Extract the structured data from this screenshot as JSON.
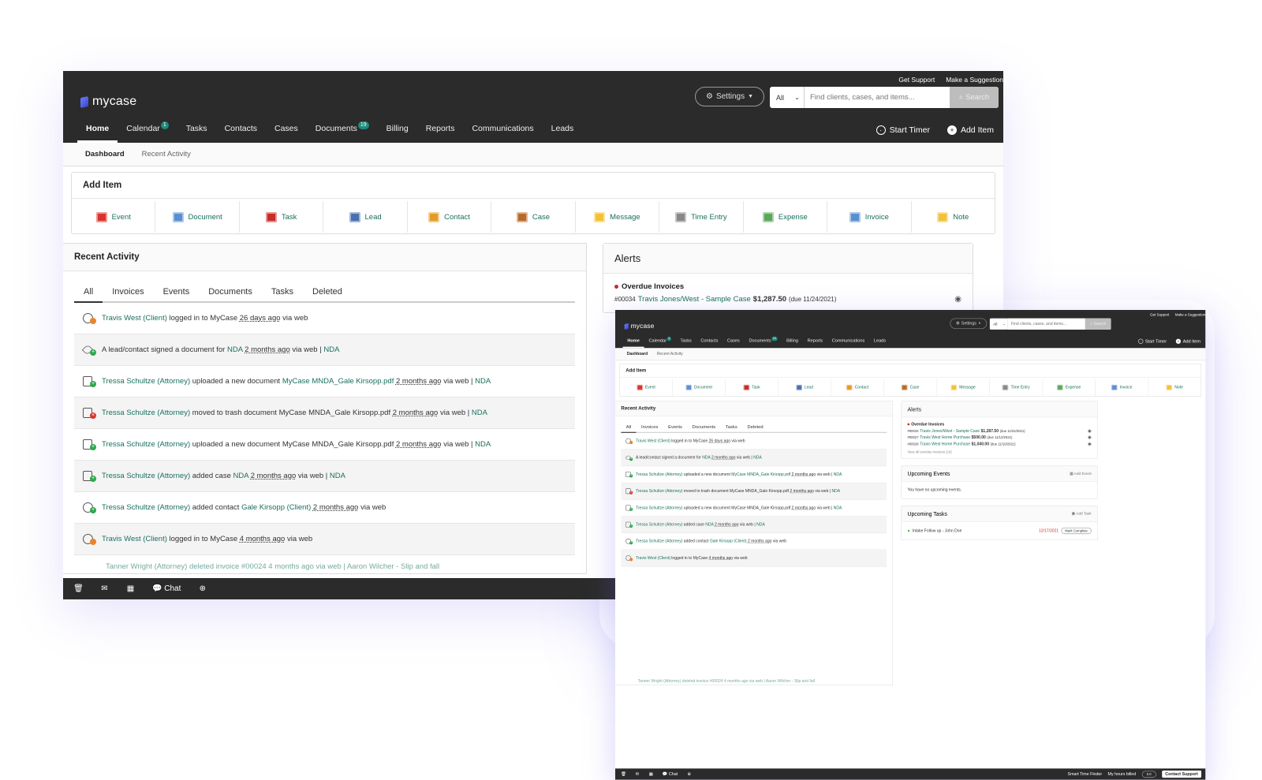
{
  "toplinks": [
    "Get Support",
    "Make a Suggestion"
  ],
  "logo": "mycase",
  "settings": "Settings",
  "search": {
    "scope": "All",
    "placeholder": "Find clients, cases, and items...",
    "button": "Search"
  },
  "nav": [
    {
      "label": "Home",
      "badge": ""
    },
    {
      "label": "Calendar",
      "badge": "1"
    },
    {
      "label": "Tasks",
      "badge": ""
    },
    {
      "label": "Contacts",
      "badge": ""
    },
    {
      "label": "Cases",
      "badge": ""
    },
    {
      "label": "Documents",
      "badge": "19"
    },
    {
      "label": "Billing",
      "badge": ""
    },
    {
      "label": "Reports",
      "badge": ""
    },
    {
      "label": "Communications",
      "badge": ""
    },
    {
      "label": "Leads",
      "badge": ""
    }
  ],
  "nav_right": {
    "timer": "Start Timer",
    "add": "Add Item"
  },
  "subnav": [
    "Dashboard",
    "Recent Activity"
  ],
  "add_item": {
    "title": "Add Item",
    "items": [
      {
        "label": "Event",
        "color": "#d9342b"
      },
      {
        "label": "Document",
        "color": "#5a8fd0"
      },
      {
        "label": "Task",
        "color": "#c62d28"
      },
      {
        "label": "Lead",
        "color": "#4a6fb0"
      },
      {
        "label": "Contact",
        "color": "#e39a2a"
      },
      {
        "label": "Case",
        "color": "#b86a2a"
      },
      {
        "label": "Message",
        "color": "#f0c23a"
      },
      {
        "label": "Time Entry",
        "color": "#888888"
      },
      {
        "label": "Expense",
        "color": "#5aa85a"
      },
      {
        "label": "Invoice",
        "color": "#5a8fd0"
      },
      {
        "label": "Note",
        "color": "#f0c23a"
      }
    ]
  },
  "recent": {
    "title": "Recent Activity",
    "tabs": [
      "All",
      "Invoices",
      "Events",
      "Documents",
      "Tasks",
      "Deleted"
    ],
    "rows": [
      {
        "icon": "client-login-icon",
        "type": "person",
        "badge": "orange",
        "a": "Travis West (Client)",
        "b": "logged in to MyCase",
        "t": "26 days ago",
        "c": "via web",
        "d": ""
      },
      {
        "icon": "signed-document-icon",
        "type": "pen",
        "badge": "green",
        "a": "",
        "b": "A lead/contact signed a document for",
        "a2": "NDA",
        "t": "2 months ago",
        "c": "via web |",
        "d": "NDA"
      },
      {
        "icon": "document-add-icon",
        "type": "doc",
        "badge": "green",
        "a": "Tressa Schultze (Attorney)",
        "b": "uploaded a new document",
        "a2": "MyCase MNDA_Gale Kirsopp.pdf",
        "t": "2 months ago",
        "c": "via web |",
        "d": "NDA"
      },
      {
        "icon": "document-trash-icon",
        "type": "doc",
        "badge": "red",
        "a": "Tressa Schultze (Attorney)",
        "b": "moved to trash document MyCase MNDA_Gale Kirsopp.pdf",
        "t": "2 months ago",
        "c": "via web |",
        "d": "NDA"
      },
      {
        "icon": "document-add-icon",
        "type": "doc",
        "badge": "green",
        "a": "Tressa Schultze (Attorney)",
        "b": "uploaded a new document MyCase MNDA_Gale Kirsopp.pdf",
        "t": "2 months ago",
        "c": "via web |",
        "d": "NDA"
      },
      {
        "icon": "case-add-icon",
        "type": "case",
        "badge": "green",
        "a": "Tressa Schultze (Attorney)",
        "b": "added case",
        "a2": "NDA",
        "t": "2 months ago",
        "c": "via web |",
        "d": "NDA"
      },
      {
        "icon": "contact-add-icon",
        "type": "person",
        "badge": "green",
        "a": "Tressa Schultze (Attorney)",
        "b": "added contact",
        "a2": "Gale Kirsopp (Client)",
        "t": "2 months ago",
        "c": "via web",
        "d": ""
      },
      {
        "icon": "client-login-icon",
        "type": "person",
        "badge": "orange",
        "a": "Travis West (Client)",
        "b": "logged in to MyCase",
        "t": "4 months ago",
        "c": "via web",
        "d": ""
      }
    ],
    "faded": "Tanner Wright (Attorney) deleted invoice #00024 4 months ago via web | Aaron Wilcher - Slip and fall"
  },
  "alerts": {
    "title": "Alerts",
    "overdue_title": "Overdue Invoices",
    "invoices": [
      {
        "num": "#00034",
        "name": "Travis Jones/West - Sample Case",
        "amount": "$1,287.50",
        "due": "(due 11/24/2021)"
      },
      {
        "num": "#00027",
        "name": "Travis West Home Purchase",
        "amount": "$500.00",
        "due": "(due 11/12/2021)"
      },
      {
        "num": "#00028",
        "name": "Travis West Home Purchase",
        "amount": "$1,040.00",
        "due": "(due 11/10/2021)"
      }
    ],
    "view_all": "View all overdue invoices (16)"
  },
  "upcoming_events": {
    "title": "Upcoming Events",
    "action": "Add Event",
    "empty": "You have no upcoming events."
  },
  "upcoming_tasks": {
    "title": "Upcoming Tasks",
    "action": "Add Task",
    "task": "Intake Follow up - John Doe",
    "due": "12/17/2021",
    "button": "Mark Complete"
  },
  "bottombar": {
    "chat": "Chat",
    "smart": "Smart Time Finder",
    "billed": "My hours billed",
    "toggle": "0.0",
    "support": "Contact Support"
  }
}
